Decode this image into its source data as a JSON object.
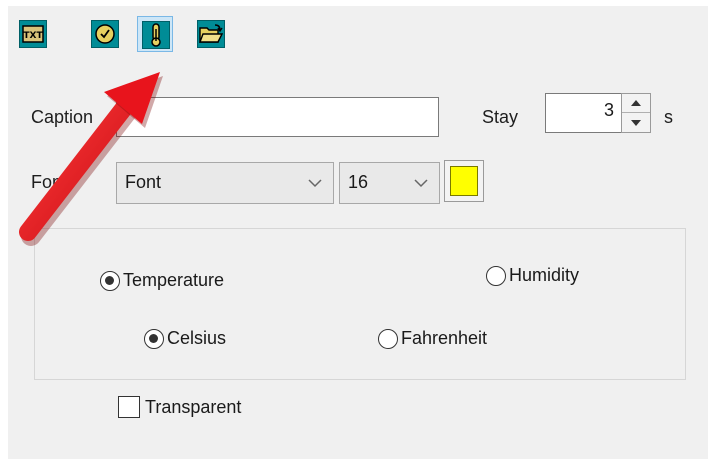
{
  "toolbar": {
    "buttons": [
      {
        "icon": "txt-icon",
        "glyph": "TXT"
      },
      {
        "icon": "clock-icon"
      },
      {
        "icon": "thermometer-icon"
      },
      {
        "icon": "folder-open-icon"
      }
    ],
    "selected_index": 2
  },
  "form": {
    "caption_label": "Caption",
    "caption_value": "",
    "stay_label": "Stay",
    "stay_value": "3",
    "stay_unit": "s",
    "font_label": "Font",
    "font_select": "Font",
    "size_select": "16",
    "color": "#ffff00"
  },
  "options": {
    "temperature": "Temperature",
    "humidity": "Humidity",
    "celsius": "Celsius",
    "fahrenheit": "Fahrenheit",
    "transparent": "Transparent"
  },
  "colors": {
    "accent": "#008c96",
    "arrow": "#e8141c"
  }
}
